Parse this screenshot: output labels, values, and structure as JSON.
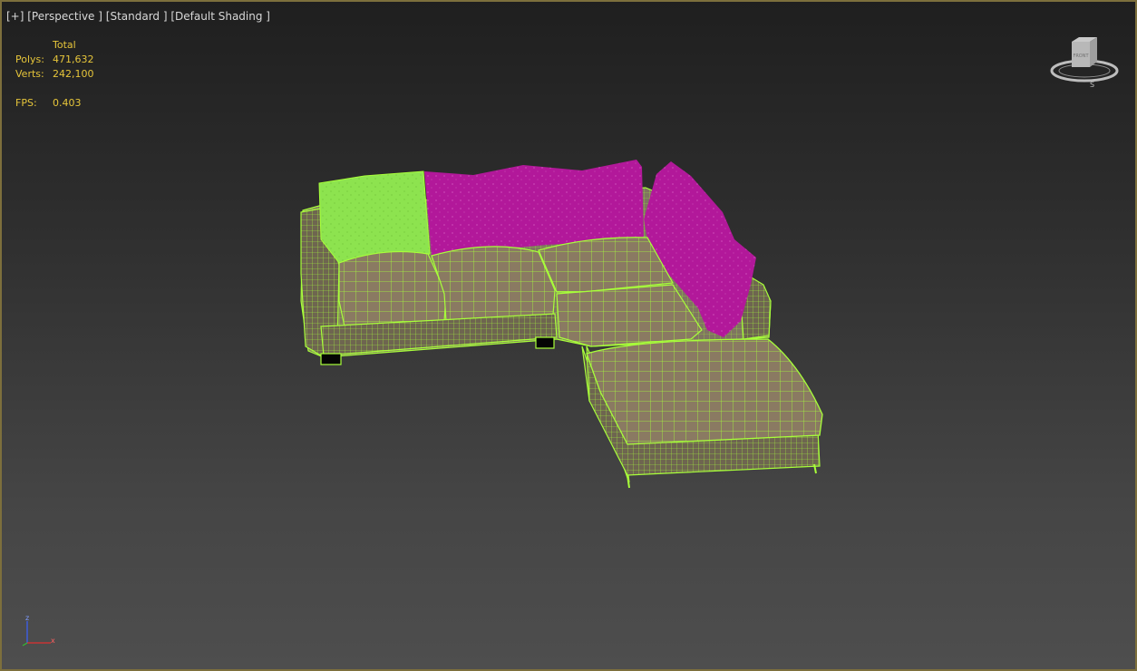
{
  "viewport": {
    "label_plus": "[+]",
    "label_view": "[Perspective ]",
    "label_mode": "[Standard ]",
    "label_shading": "[Default Shading ]"
  },
  "stats": {
    "header": "Total",
    "polys_label": "Polys:",
    "polys_value": "471,632",
    "verts_label": "Verts:",
    "verts_value": "242,100",
    "fps_label": "FPS:",
    "fps_value": "0.403"
  },
  "viewcube": {
    "face_label": "FRONT"
  },
  "axis": {
    "x": "x",
    "z": "z"
  },
  "colors": {
    "wire": "#a8ff3a",
    "cushion_fill": "#8a7a62",
    "pillow_green": "#8de34f",
    "pillow_magenta": "#b2189a",
    "stat_text": "#e6c53a",
    "border": "#7d6f3c"
  }
}
